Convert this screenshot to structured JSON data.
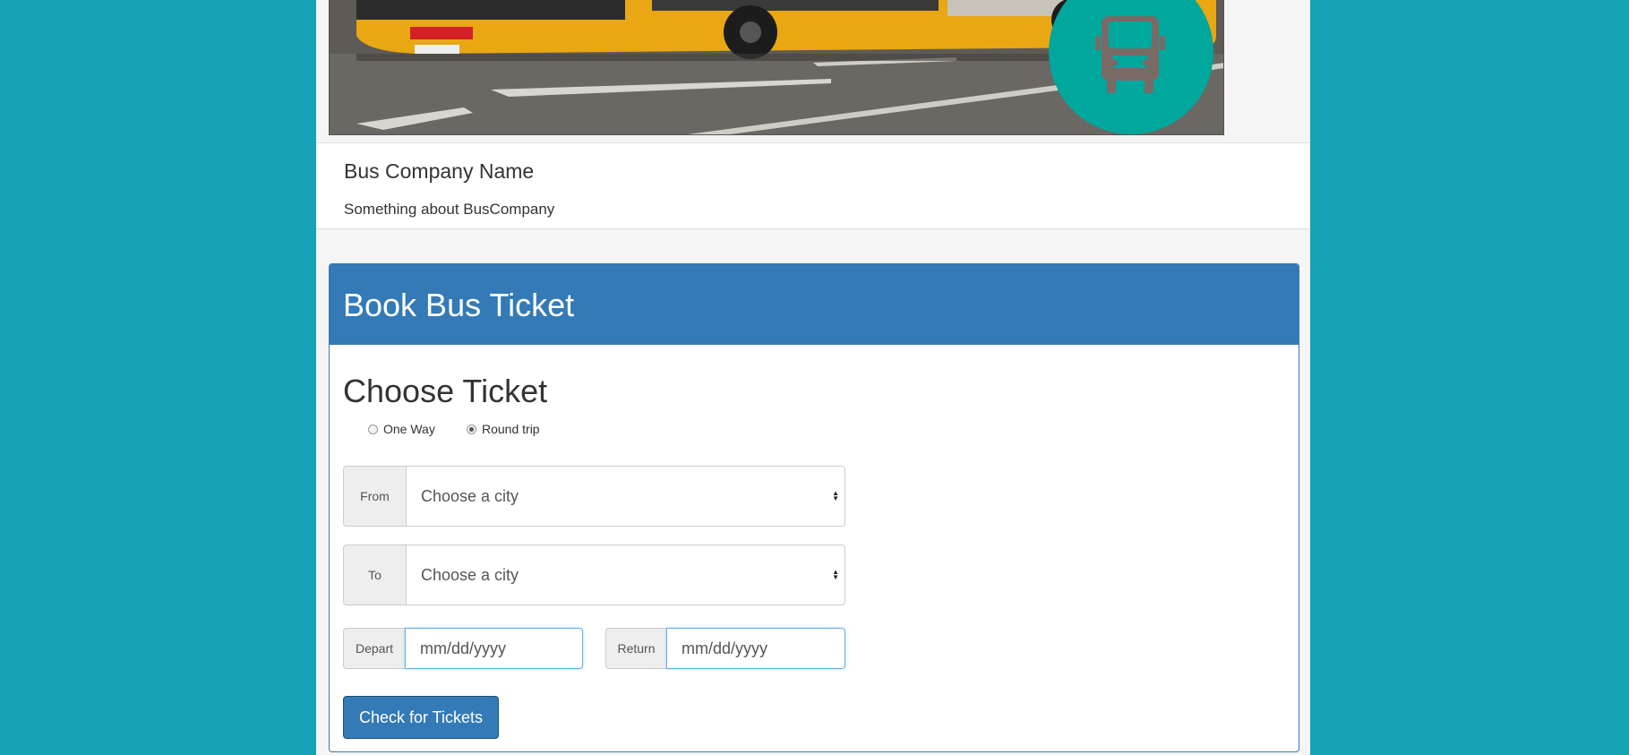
{
  "company": {
    "name": "Bus Company Name",
    "description": "Something about BusCompany"
  },
  "banner": {
    "image_subject": "yellow city bus",
    "logo_icon": "bus-icon",
    "logo_color": "#00a79d"
  },
  "booking": {
    "panel_title": "Book Bus Ticket",
    "section_title": "Choose Ticket",
    "trip_options": [
      {
        "label": "One Way",
        "checked": false
      },
      {
        "label": "Round trip",
        "checked": true
      }
    ],
    "from": {
      "label": "From",
      "placeholder": "Choose a city"
    },
    "to": {
      "label": "To",
      "placeholder": "Choose a city"
    },
    "depart": {
      "label": "Depart",
      "placeholder": "mm/dd/yyyy"
    },
    "return": {
      "label": "Return",
      "placeholder": "mm/dd/yyyy"
    },
    "submit_label": "Check for Tickets"
  },
  "colors": {
    "page_background": "#17a2b8",
    "primary": "#337ab7"
  }
}
